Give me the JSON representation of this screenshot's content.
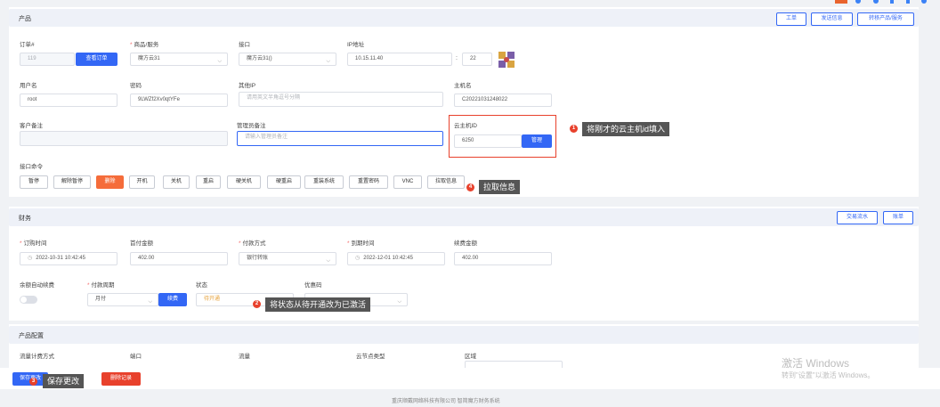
{
  "product": {
    "title": "产品",
    "actions": [
      "工单",
      "发送信息",
      "转移产品/服务"
    ],
    "order_label": "订单#",
    "order_value": "119",
    "view_order": "查看订单",
    "service_label": "商品/服务",
    "service_value": "魔方云31",
    "interface_label": "接口",
    "interface_value": "魔方云31()",
    "ip_label": "IP地址",
    "ip_value": "10.15.11.40",
    "port_value": "22",
    "username_label": "用户名",
    "username_value": "root",
    "password_label": "密码",
    "password_value": "9LWZf2Xv0qtYFe",
    "other_ip_label": "其他IP",
    "other_ip_placeholder": "请用英文半角逗号分隔",
    "hostname_label": "主机名",
    "hostname_value": "C20221031248022",
    "customer_note_label": "客户备注",
    "admin_note_label": "管理员备注",
    "admin_note_placeholder": "请输入管理员备注",
    "cloud_id_label": "云主机ID",
    "cloud_id_value": "6250",
    "manage": "管理",
    "cmd_label": "接口命令",
    "commands": [
      "暂停",
      "解除暂停",
      "删除",
      "开机",
      "关机",
      "重启",
      "硬关机",
      "硬重启",
      "重装系统",
      "重置密码",
      "VNC",
      "拉取信息"
    ]
  },
  "finance": {
    "title": "财务",
    "actions": [
      "交易流水",
      "账单"
    ],
    "order_time_label": "订购时间",
    "order_time_value": "2022-10-31 10:42:45",
    "first_amount_label": "首付金额",
    "first_amount_value": "402.00",
    "pay_method_label": "付款方式",
    "pay_method_value": "银行转账",
    "expire_label": "到期时间",
    "expire_value": "2022-12-01 10:42:45",
    "renew_amount_label": "续费金额",
    "renew_amount_value": "402.00",
    "auto_renew_label": "余额自动续费",
    "cycle_label": "付款周期",
    "cycle_value": "月付",
    "renew_btn": "续费",
    "status_label": "状态",
    "status_value": "待开通",
    "coupon_label": "优惠码"
  },
  "config": {
    "title": "产品配置",
    "fields": [
      "流量计费方式",
      "端口",
      "流量",
      "云节点类型",
      "区域"
    ]
  },
  "footer": {
    "save": "保存更改",
    "delete": "删除记录",
    "copyright": "重庆顺戴网络科技有限公司 智简魔方财务系统"
  },
  "annotations": {
    "a1": "将刚才的云主机id填入",
    "a2": "将状态从待开通改为已激活",
    "a3": "保存更改",
    "a4": "拉取信息"
  },
  "watermark": {
    "line1": "激活 Windows",
    "line2": "转到\"设置\"以激活 Windows。"
  }
}
